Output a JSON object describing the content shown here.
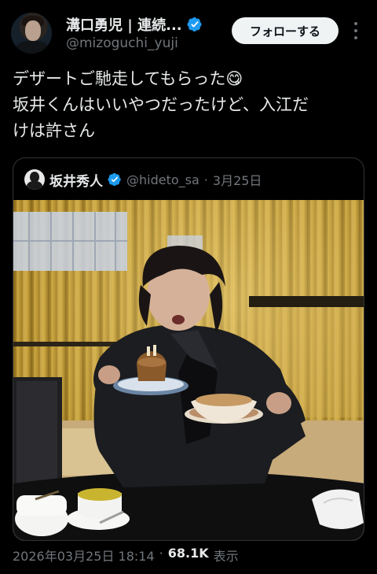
{
  "author": {
    "display_name": "溝口勇児 | 連続...",
    "handle": "@mizoguchi_yuji",
    "follow_label": "フォローする"
  },
  "tweet": {
    "lines": [
      "デザートご馳走してもらった😋",
      "坂井くんはいいやつだったけど、入江だ",
      "けは許さん"
    ]
  },
  "quote": {
    "name": "坂井秀人",
    "handle": "@hideto_sa",
    "separator": "·",
    "date": "3月25日"
  },
  "footer": {
    "timestamp": "2026年03月25日 18:14",
    "separator": "·",
    "views": "68.1K",
    "views_label": "表示"
  },
  "icons": {
    "verified": "verified-badge-icon",
    "more": "more-dots-icon"
  },
  "colors": {
    "verified_blue": "#1d9bf0",
    "background": "#000000",
    "muted_text": "#71767b",
    "follow_bg": "#eff3f4"
  }
}
